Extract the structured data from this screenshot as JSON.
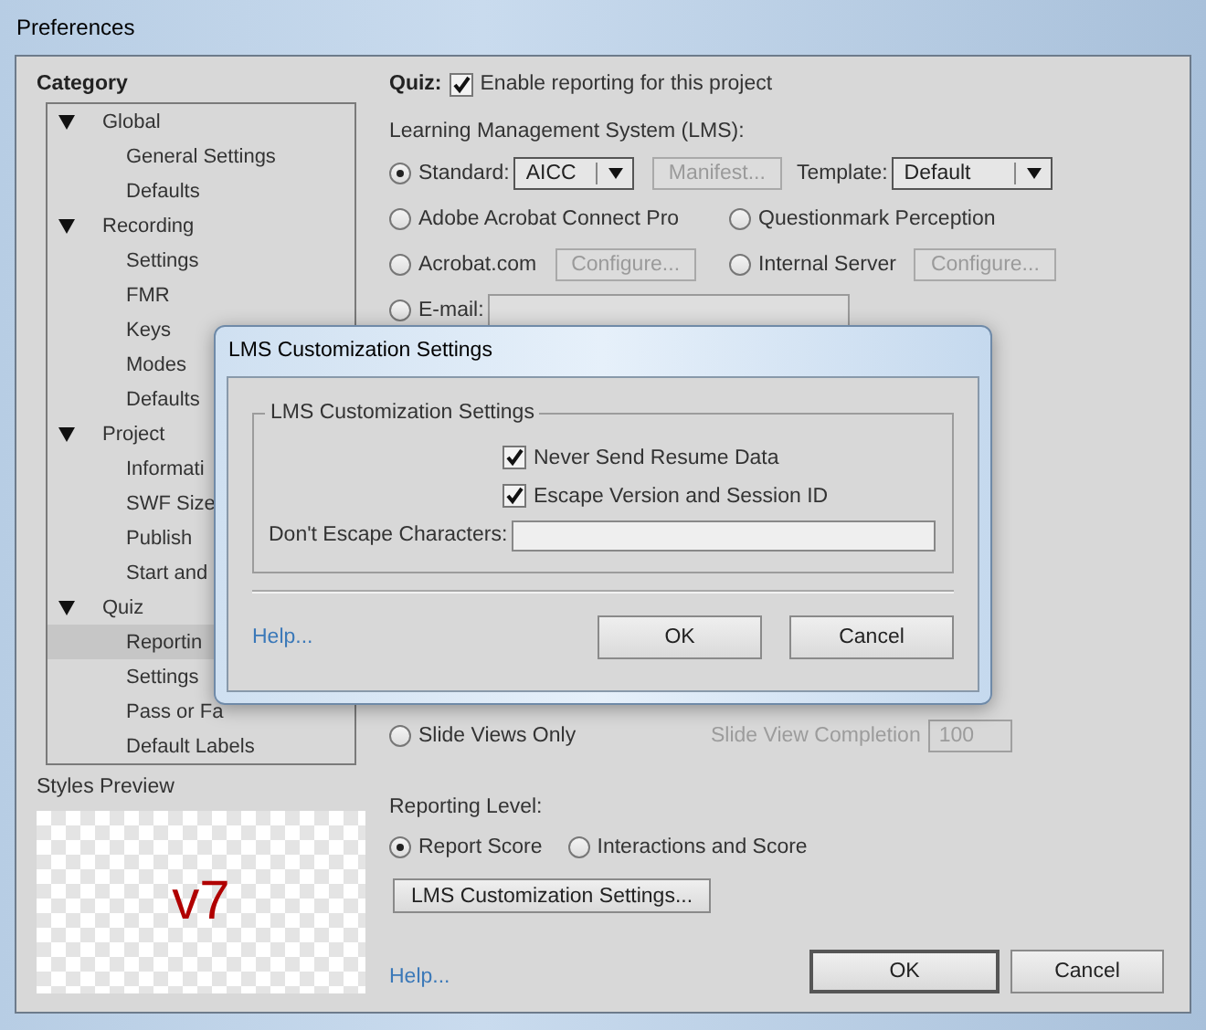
{
  "window": {
    "title": "Preferences"
  },
  "sidebar": {
    "heading": "Category",
    "tree": [
      {
        "label": "Global",
        "expanded": true,
        "selected": false,
        "children": [
          {
            "label": "General Settings",
            "selected": false
          },
          {
            "label": "Defaults",
            "selected": false
          }
        ]
      },
      {
        "label": "Recording",
        "expanded": true,
        "selected": false,
        "children": [
          {
            "label": "Settings",
            "selected": false
          },
          {
            "label": "FMR",
            "selected": false
          },
          {
            "label": "Keys",
            "selected": false
          },
          {
            "label": "Modes",
            "selected": false
          },
          {
            "label": "Defaults",
            "selected": false
          }
        ]
      },
      {
        "label": "Project",
        "expanded": true,
        "selected": false,
        "children": [
          {
            "label": "Informati",
            "selected": false
          },
          {
            "label": "SWF Size",
            "selected": false
          },
          {
            "label": "Publish",
            "selected": false
          },
          {
            "label": "Start and",
            "selected": false
          }
        ]
      },
      {
        "label": "Quiz",
        "expanded": true,
        "selected": false,
        "children": [
          {
            "label": "Reportin",
            "selected": true
          },
          {
            "label": "Settings",
            "selected": false
          },
          {
            "label": "Pass or Fa",
            "selected": false
          },
          {
            "label": "Default Labels",
            "selected": false
          }
        ]
      }
    ]
  },
  "styles_preview": {
    "label": "Styles Preview",
    "sample": "v7"
  },
  "quiz": {
    "label": "Quiz:",
    "checkbox": {
      "label": "Enable reporting for this project",
      "checked": true
    }
  },
  "lms": {
    "label": "Learning Management System (LMS):",
    "rows": [
      {
        "cells": [
          [
            {
              "kind": "radio",
              "label": "Standard:",
              "selected": true
            },
            {
              "kind": "dropdown",
              "value": "AICC"
            },
            {
              "kind": "button",
              "label": "Manifest...",
              "disabled": true
            },
            {
              "kind": "text",
              "text": "Template:"
            },
            {
              "kind": "dropdown",
              "value": "Default"
            }
          ]
        ]
      },
      {
        "cells": [
          [
            {
              "kind": "radio",
              "label": "Adobe Acrobat Connect Pro",
              "selected": false
            }
          ],
          [
            {
              "kind": "radio",
              "label": "Questionmark Perception",
              "selected": false
            }
          ]
        ]
      },
      {
        "cells": [
          [
            {
              "kind": "radio",
              "label": "Acrobat.com",
              "selected": false
            },
            {
              "kind": "button",
              "label": "Configure...",
              "disabled": true
            }
          ],
          [
            {
              "kind": "radio",
              "label": "Internal Server",
              "selected": false
            },
            {
              "kind": "button",
              "label": "Configure...",
              "disabled": true
            }
          ]
        ]
      },
      {
        "cells": [
          [
            {
              "kind": "radio",
              "label": "E-mail:",
              "selected": false
            },
            {
              "kind": "field"
            }
          ]
        ]
      }
    ]
  },
  "slide_views": {
    "radio": {
      "label": "Slide Views Only",
      "selected": false
    },
    "completion": {
      "label": "Slide View Completion",
      "value": "100",
      "disabled": true
    }
  },
  "reporting_level": {
    "label": "Reporting Level:",
    "options": [
      {
        "label": "Report Score",
        "selected": true
      },
      {
        "label": "Interactions and Score",
        "selected": false
      }
    ],
    "button": "LMS Customization Settings..."
  },
  "footer": {
    "help": "Help...",
    "buttons": [
      {
        "label": "OK",
        "default": true
      },
      {
        "label": "Cancel",
        "default": false
      }
    ]
  },
  "dialog": {
    "title": "LMS Customization Settings",
    "group": "LMS Customization Settings",
    "checkboxes": [
      {
        "label": "Never Send Resume Data",
        "checked": true
      },
      {
        "label": "Escape Version and Session ID",
        "checked": true
      }
    ],
    "field": {
      "label": "Don't Escape Characters:"
    },
    "help": "Help...",
    "buttons": [
      {
        "label": "OK"
      },
      {
        "label": "Cancel"
      }
    ]
  }
}
